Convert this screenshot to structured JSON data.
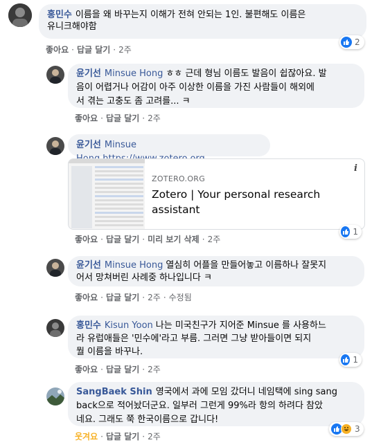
{
  "comments": [
    {
      "author": "홍민수",
      "text_line1": "이름을 왜 바꾸는지 이해가 전혀 안되는 1인. 불편해도 이름은",
      "text_line2": "유니크해야함",
      "like_label": "좋아요",
      "reply_label": "답글 달기",
      "time": "2주",
      "reaction_count": "2",
      "reaction_icons": [
        "like-icon"
      ]
    },
    {
      "author": "윤기선",
      "mention": "Minsue Hong",
      "text_line1": "ㅎㅎ 근데 형님 이름도 발음이 쉽잖아요. 발",
      "text_line2": "음이 어렵거나 어감이 아주 이상한 이름을 가진 사람들이 해외에",
      "text_line3": "서 겪는 고충도 좀 고려를... ㅋ",
      "like_label": "좋아요",
      "reply_label": "답글 달기",
      "time": "2주"
    },
    {
      "author": "윤기선",
      "mention": "Minsue Hong",
      "link": "https://www.zotero.org",
      "card": {
        "domain": "ZOTERO.ORG",
        "title_line1": "Zotero | Your personal research",
        "title_line2": "assistant",
        "info_icon": "info-icon"
      },
      "like_label": "좋아요",
      "reply_label": "답글 달기",
      "preview_label": "미리 보기 삭제",
      "time": "2주",
      "reaction_count": "1",
      "reaction_icons": [
        "like-icon"
      ]
    },
    {
      "author": "윤기선",
      "mention": "Minsue Hong",
      "text_line1": "열심히 어플을 만들어놓고 이름하나 잘못지",
      "text_line2": "어서 망쳐버린 사례중 하나입니다 ㅋ",
      "like_label": "좋아요",
      "reply_label": "답글 달기",
      "time": "2주",
      "edited_label": "수정됨"
    },
    {
      "author": "홍민수",
      "mention": "Kisun Yoon",
      "text_line1": "나는 미국친구가 지어준 Minsue 를 사용하느",
      "text_line2": "라 유럽애들은 '민수에'라고 부름. 그러면 그냥 받아들이면 되지",
      "text_line3": "뭘 이름을 바꾸나.",
      "like_label": "좋아요",
      "reply_label": "답글 달기",
      "time": "2주",
      "reaction_count": "1",
      "reaction_icons": [
        "like-icon"
      ]
    },
    {
      "author": "SangBaek Shin",
      "text_line1": "영국에서 과에 모임 갔더니 네임택에 sing sang",
      "text_line2": "back으로 적어놨더군요. 일부러 그런게 99%라 항의 하려다 참았",
      "text_line3": "네요. 그래도 쭉 한국이름으로 갑니다!",
      "like_label": "웃겨요",
      "reply_label": "답글 달기",
      "time": "2주",
      "reaction_count": "3",
      "reaction_icons": [
        "like-icon",
        "haha-icon"
      ],
      "like_label_color": "#f7b125"
    }
  ],
  "colors": {
    "bubble_bg": "#f0f2f5",
    "link": "#385898",
    "meta": "#65676b",
    "like_blue": "#1877f2",
    "haha_yellow": "#f7b125"
  }
}
